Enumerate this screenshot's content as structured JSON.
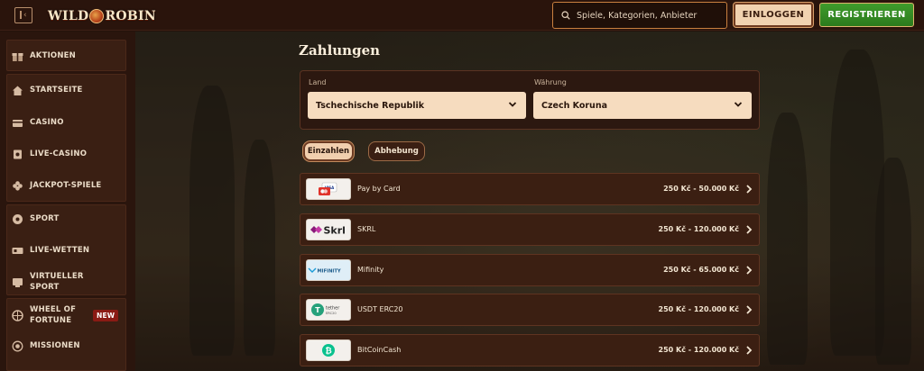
{
  "header": {
    "logo_text_left": "WILD",
    "logo_text_right": "ROBIN",
    "search_placeholder": "Spiele, Kategorien, Anbieter",
    "login_label": "EINLOGGEN",
    "register_label": "REGISTRIEREN"
  },
  "sidebar": {
    "items": [
      {
        "label": "AKTIONEN",
        "icon": "gift-icon"
      },
      {
        "label": "STARTSEITE",
        "icon": "home-icon"
      },
      {
        "label": "CASINO",
        "icon": "cards-icon"
      },
      {
        "label": "LIVE-CASINO",
        "icon": "live-casino-icon"
      },
      {
        "label": "JACKPOT-SPIELE",
        "icon": "clover-icon"
      },
      {
        "label": "SPORT",
        "icon": "ball-icon"
      },
      {
        "label": "LIVE-WETTEN",
        "icon": "live-icon"
      },
      {
        "label": "VIRTUELLER SPORT",
        "icon": "virtual-sport-icon"
      },
      {
        "label": "WHEEL OF FORTUNE",
        "icon": "wheel-icon",
        "badge": "NEW"
      },
      {
        "label": "MISSIONEN",
        "icon": "target-icon"
      }
    ]
  },
  "main": {
    "title": "Zahlungen",
    "country_label": "Land",
    "country_value": "Tschechische Republik",
    "currency_label": "Währung",
    "currency_value": "Czech Koruna",
    "tabs": [
      {
        "label": "Einzahlen",
        "active": true
      },
      {
        "label": "Abhebung",
        "active": false
      }
    ],
    "methods": [
      {
        "name": "Pay by Card",
        "range": "250 Kč - 50.000 Kč",
        "logo": "card-logo"
      },
      {
        "name": "SKRL",
        "range": "250 Kč - 120.000 Kč",
        "logo": "skrill-logo",
        "logo_text": "Skrl"
      },
      {
        "name": "Mifinity",
        "range": "250 Kč - 65.000 Kč",
        "logo": "mifinity-logo",
        "logo_text": "MIFINITY"
      },
      {
        "name": "USDT ERC20",
        "range": "250 Kč - 120.000 Kč",
        "logo": "tether-logo",
        "logo_text": "tether",
        "logo_subtext": "ERC20"
      },
      {
        "name": "BitCoinCash",
        "range": "250 Kč - 120.000 Kč",
        "logo": "bitcoincash-logo"
      }
    ]
  },
  "colors": {
    "accent": "#c9803f",
    "register_green": "#3f9b2c",
    "new_badge": "#8a1a14"
  }
}
